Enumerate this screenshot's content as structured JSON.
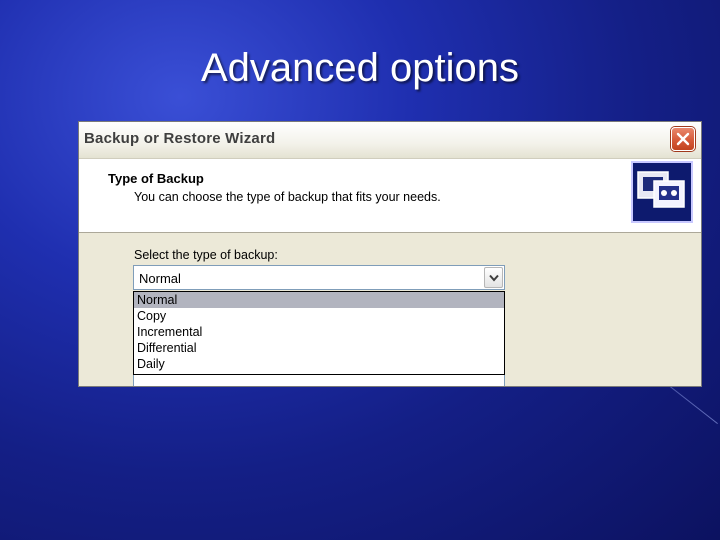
{
  "slide": {
    "title": "Advanced options"
  },
  "dialog": {
    "title": "Backup or Restore Wizard",
    "close_icon": "close-icon",
    "header": {
      "title": "Type of Backup",
      "subtitle": "You can choose the type of backup that fits your needs.",
      "icon": "backup-wizard-icon"
    },
    "select_label": "Select the type of backup:",
    "combo": {
      "value": "Normal",
      "arrow_icon": "chevron-down-icon"
    },
    "options": [
      {
        "label": "Normal",
        "selected": true
      },
      {
        "label": "Copy",
        "selected": false
      },
      {
        "label": "Incremental",
        "selected": false
      },
      {
        "label": "Differential",
        "selected": false
      },
      {
        "label": "Daily",
        "selected": false
      }
    ]
  },
  "colors": {
    "background": "#1f2fb0",
    "dialog_face": "#ece9d8",
    "close_button": "#d65a3a",
    "selected_option": "#b2b4bf"
  }
}
